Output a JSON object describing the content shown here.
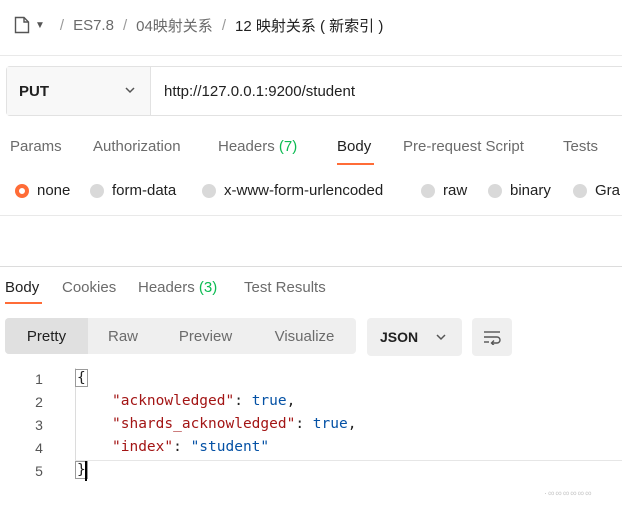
{
  "breadcrumb": {
    "items": [
      "ES7.8",
      "04映射关系"
    ],
    "current": "12 映射关系 ( 新索引 )"
  },
  "request": {
    "method": "PUT",
    "url": "http://127.0.0.1:9200/student"
  },
  "request_tabs": {
    "params": "Params",
    "authorization": "Authorization",
    "headers": "Headers",
    "headers_count": "(7)",
    "body": "Body",
    "prerequest": "Pre-request Script",
    "tests": "Tests"
  },
  "body_types": [
    "none",
    "form-data",
    "x-www-form-urlencoded",
    "raw",
    "binary",
    "Gra"
  ],
  "body_type_selected": "none",
  "response_tabs": {
    "body": "Body",
    "cookies": "Cookies",
    "headers": "Headers",
    "headers_count": "(3)",
    "test_results": "Test Results"
  },
  "view_modes": [
    "Pretty",
    "Raw",
    "Preview",
    "Visualize"
  ],
  "view_mode_selected": "Pretty",
  "format": "JSON",
  "code": {
    "line_numbers": [
      "1",
      "2",
      "3",
      "4",
      "5"
    ],
    "open_brace": "{",
    "close_brace": "}",
    "entries": [
      {
        "key": "\"acknowledged\"",
        "colon": ": ",
        "value": "true",
        "comma": ","
      },
      {
        "key": "\"shards_acknowledged\"",
        "colon": ": ",
        "value": "true",
        "comma": ","
      },
      {
        "key": "\"index\"",
        "colon": ": ",
        "value": "\"student\"",
        "comma": ""
      }
    ]
  },
  "watermark": "·∞∞∞∞∞∞",
  "colors": {
    "accent": "#ff6c37",
    "count_green": "#0cbb52",
    "json_key": "#a31515",
    "json_value": "#0451a5"
  },
  "icons": [
    "file-icon",
    "caret-down-icon",
    "chevron-down-icon",
    "wrap-lines-icon"
  ]
}
